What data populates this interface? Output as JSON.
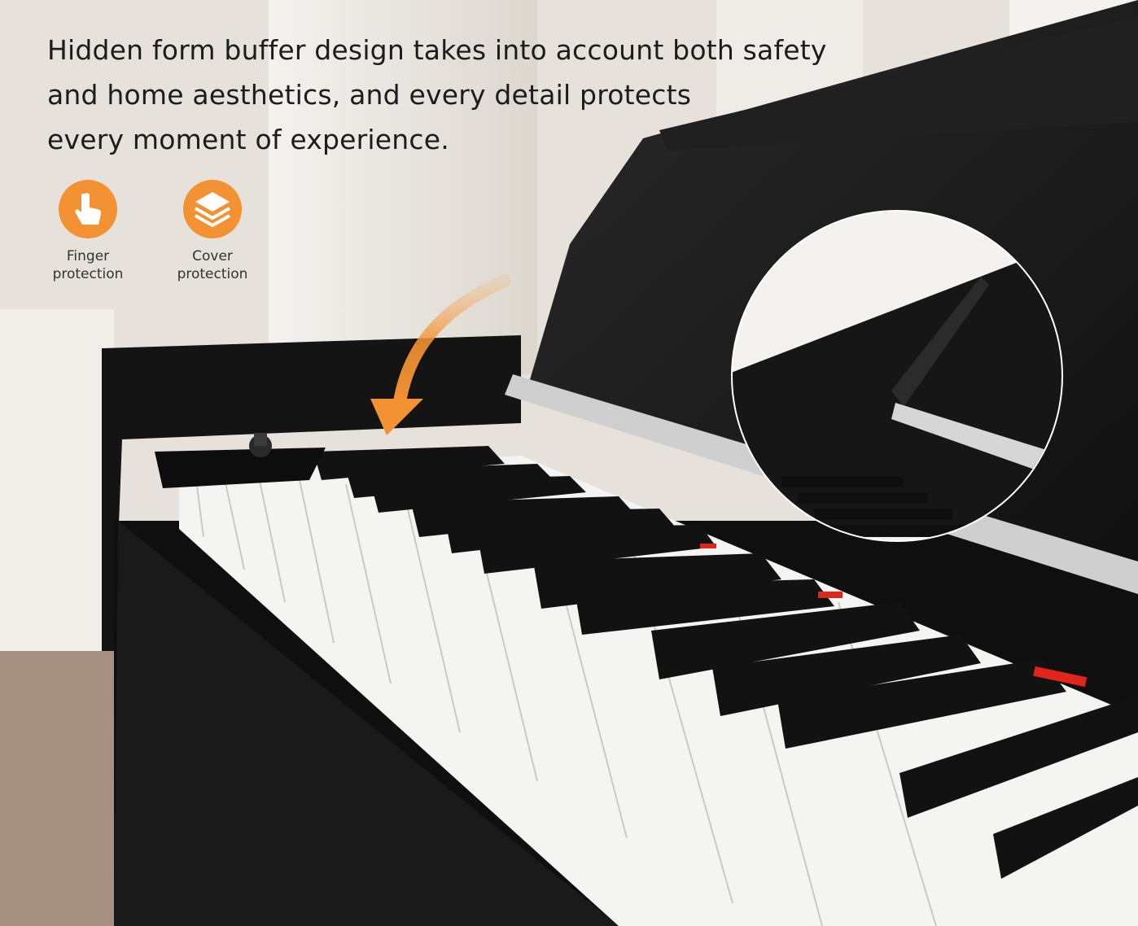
{
  "headline": {
    "line1": "Hidden form buffer design takes into account both safety",
    "line2": "and home aesthetics, and every detail protects",
    "line3": "every moment of experience."
  },
  "features": [
    {
      "icon": "finger-touch-icon",
      "line1": "Finger",
      "line2": "protection"
    },
    {
      "icon": "layers-icon",
      "line1": "Cover",
      "line2": "protection"
    }
  ],
  "colors": {
    "accent": "#f39233",
    "piano_body": "#161616",
    "white_key": "#f4f4f2",
    "indicator": "#e0261c"
  }
}
